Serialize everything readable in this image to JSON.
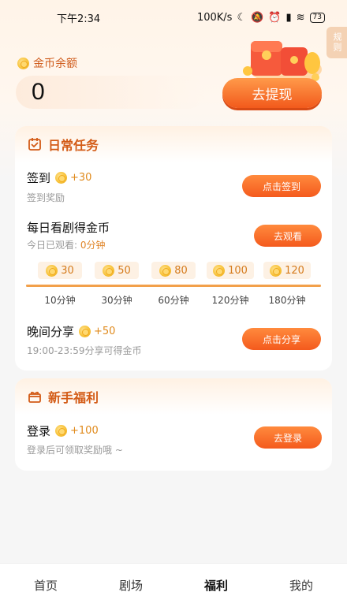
{
  "status_bar": {
    "time": "下午2:34",
    "network_speed": "100K/s",
    "battery": "73"
  },
  "rules_tag": "规则",
  "balance": {
    "label": "金币余额",
    "value": "0",
    "withdraw_label": "去提现"
  },
  "daily": {
    "title": "日常任务",
    "checkin": {
      "title": "签到",
      "reward": "+30",
      "subtitle": "签到奖励",
      "button": "点击签到"
    },
    "watch": {
      "title": "每日看剧得金币",
      "watched_label": "今日已观看: ",
      "watched_value": "0分钟",
      "button": "去观看",
      "milestones": [
        {
          "reward": "30",
          "label": "10分钟"
        },
        {
          "reward": "50",
          "label": "30分钟"
        },
        {
          "reward": "80",
          "label": "60分钟"
        },
        {
          "reward": "100",
          "label": "120分钟"
        },
        {
          "reward": "120",
          "label": "180分钟"
        }
      ],
      "progress": 0.0
    },
    "share": {
      "title": "晚间分享",
      "reward": "+50",
      "subtitle": "19:00-23:59分享可得金币",
      "button": "点击分享"
    }
  },
  "newbie": {
    "title": "新手福利",
    "login": {
      "title": "登录",
      "reward": "+100",
      "subtitle": "登录后可领取奖励哦 ~",
      "button": "去登录"
    }
  },
  "tabs": [
    {
      "label": "首页",
      "active": false
    },
    {
      "label": "剧场",
      "active": false
    },
    {
      "label": "福利",
      "active": true
    },
    {
      "label": "我的",
      "active": false
    }
  ],
  "colors": {
    "accent": "#f45a1d",
    "title_orange": "#d35b16",
    "reward_orange": "#e08a1c"
  }
}
